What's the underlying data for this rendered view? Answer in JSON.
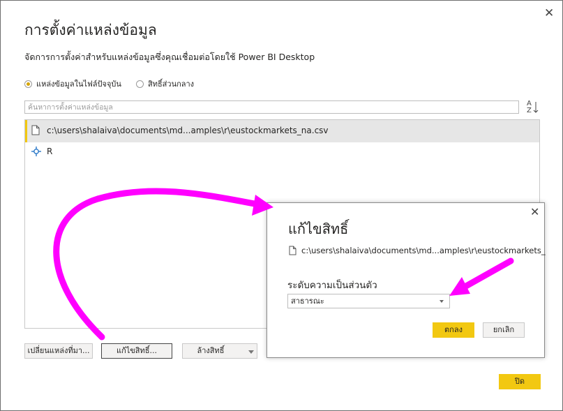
{
  "main_dialog": {
    "title": "การตั้งค่าแหล่งข้อมูล",
    "close_glyph": "✕",
    "subtitle": "จัดการการตั้งค่าสำหรับแหล่งข้อมูลซึ่งคุณเชื่อมต่อโดยใช้ Power BI Desktop",
    "scope_options": [
      {
        "label": "แหล่งข้อมูลในไฟล์ปัจจุบัน",
        "selected": true
      },
      {
        "label": "สิทธิ์ส่วนกลาง",
        "selected": false
      }
    ],
    "search_placeholder": "ค้นหาการตั้งค่าแหล่งข้อมูล",
    "sort_icon": "sort-az-icon",
    "sort_glyph_top": "A",
    "sort_glyph_bottom": "Z",
    "sources": [
      {
        "label": "c:\\users\\shalaiva\\documents\\md...amples\\r\\eustockmarkets_na.csv",
        "icon": "file-icon",
        "selected": true
      },
      {
        "label": "R",
        "icon": "r-source-icon",
        "selected": false
      }
    ],
    "buttons": {
      "change_source": "เปลี่ยนแหล่งที่มา...",
      "edit_permissions": "แก้ไขสิทธิ์...",
      "clear_permissions": "ล้างสิทธิ์",
      "close": "ปิด"
    }
  },
  "edit_permissions_dialog": {
    "title": "แก้ไขสิทธิ์",
    "close_glyph": "✕",
    "path": "c:\\users\\shalaiva\\documents\\md...amples\\r\\eustockmarkets_",
    "privacy_label": "ระดับความเป็นส่วนตัว",
    "privacy_value": "สาธารณะ",
    "ok": "ตกลง",
    "cancel": "ยกเลิก"
  },
  "colors": {
    "accent": "#f2c811",
    "annotation_arrow": "#ff00ff"
  }
}
